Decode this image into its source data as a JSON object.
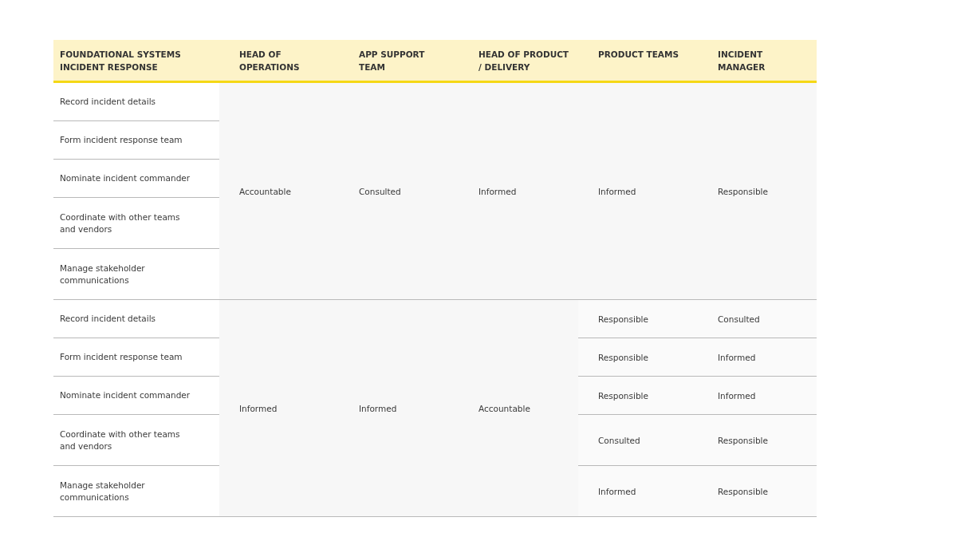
{
  "table": {
    "columns": [
      "FOUNDATIONAL SYSTEMS INCIDENT RESPONSE",
      "HEAD OF OPERATIONS",
      "APP SUPPORT TEAM",
      "HEAD OF PRODUCT / DELIVERY",
      "PRODUCT TEAMS",
      "INCIDENT MANAGER"
    ],
    "groups": [
      {
        "shared": [
          "Accountable",
          "Consulted",
          "Informed",
          "Informed",
          "Responsible"
        ],
        "rows": [
          {
            "task": "Record incident details",
            "cells": []
          },
          {
            "task": "Form incident response team",
            "cells": []
          },
          {
            "task": "Nominate incident commander",
            "cells": []
          },
          {
            "task": "Coordinate with other teams and vendors",
            "cells": []
          },
          {
            "task": "Manage stakeholder communications",
            "cells": []
          }
        ]
      },
      {
        "shared": [
          "Informed",
          "Informed",
          "Accountable"
        ],
        "rows": [
          {
            "task": "Record incident details",
            "cells": [
              "Responsible",
              "Consulted"
            ]
          },
          {
            "task": "Form incident response team",
            "cells": [
              "Responsible",
              "Informed"
            ]
          },
          {
            "task": "Nominate incident commander",
            "cells": [
              "Responsible",
              "Informed"
            ]
          },
          {
            "task": "Coordinate with other teams and vendors",
            "cells": [
              "Consulted",
              "Responsible"
            ]
          },
          {
            "task": "Manage stakeholder communications",
            "cells": [
              "Informed",
              "Responsible"
            ]
          }
        ]
      }
    ]
  }
}
